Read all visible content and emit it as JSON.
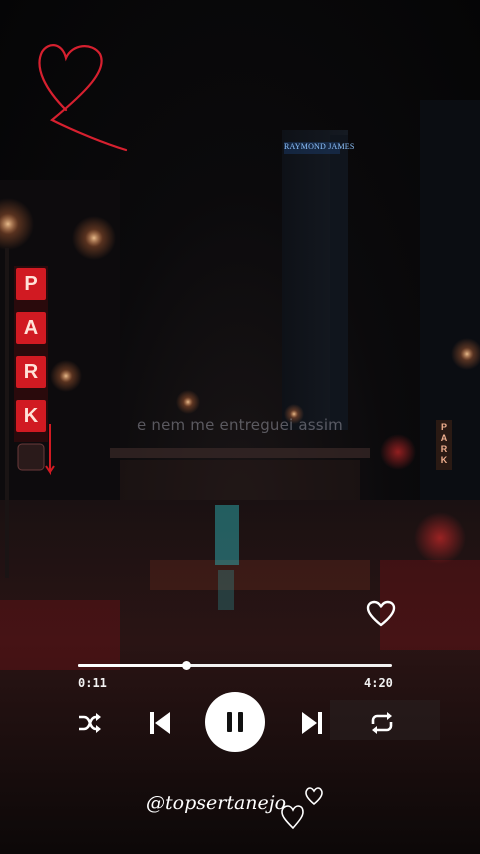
{
  "player": {
    "lyric": "e nem me entreguei assim",
    "current_time": "0:11",
    "total_time": "4:20",
    "progress": 0.345,
    "state": "playing"
  },
  "controls": {
    "shuffle_icon": "shuffle-icon",
    "previous_icon": "skip-previous-icon",
    "pause_icon": "pause-icon",
    "next_icon": "skip-next-icon",
    "repeat_icon": "repeat-icon",
    "like_icon": "heart-outline-icon"
  },
  "scene": {
    "park_sign_letters": [
      "P",
      "A",
      "R",
      "K"
    ],
    "building_sign": "RAYMOND JAMES",
    "right_sign_letters": [
      "P",
      "A",
      "R",
      "K"
    ]
  },
  "watermark": "@topsertanejo",
  "colors": {
    "accent_red": "#d6202f",
    "sign_red": "#c0121b",
    "control_white": "#ffffff",
    "background": "#07070a"
  }
}
